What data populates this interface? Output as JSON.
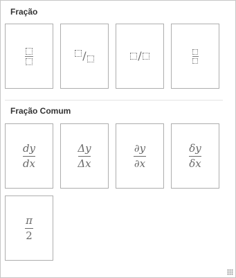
{
  "sections": {
    "fraction": {
      "title": "Fração"
    },
    "common": {
      "title": "Fração Comum"
    }
  },
  "common_fractions": {
    "dydx": {
      "num": "dy",
      "den": "dx"
    },
    "DeltaYDeltaX": {
      "num": "Δy",
      "den": "Δx"
    },
    "partialYX": {
      "num": "∂y",
      "den": "∂x"
    },
    "deltaYdeltaX": {
      "num": "δy",
      "den": "δx"
    },
    "piOver2": {
      "num": "π",
      "den": "2"
    }
  },
  "colors": {
    "tile_border": "#adadad",
    "placeholder": "#7a7a7a",
    "text": "#333333"
  }
}
